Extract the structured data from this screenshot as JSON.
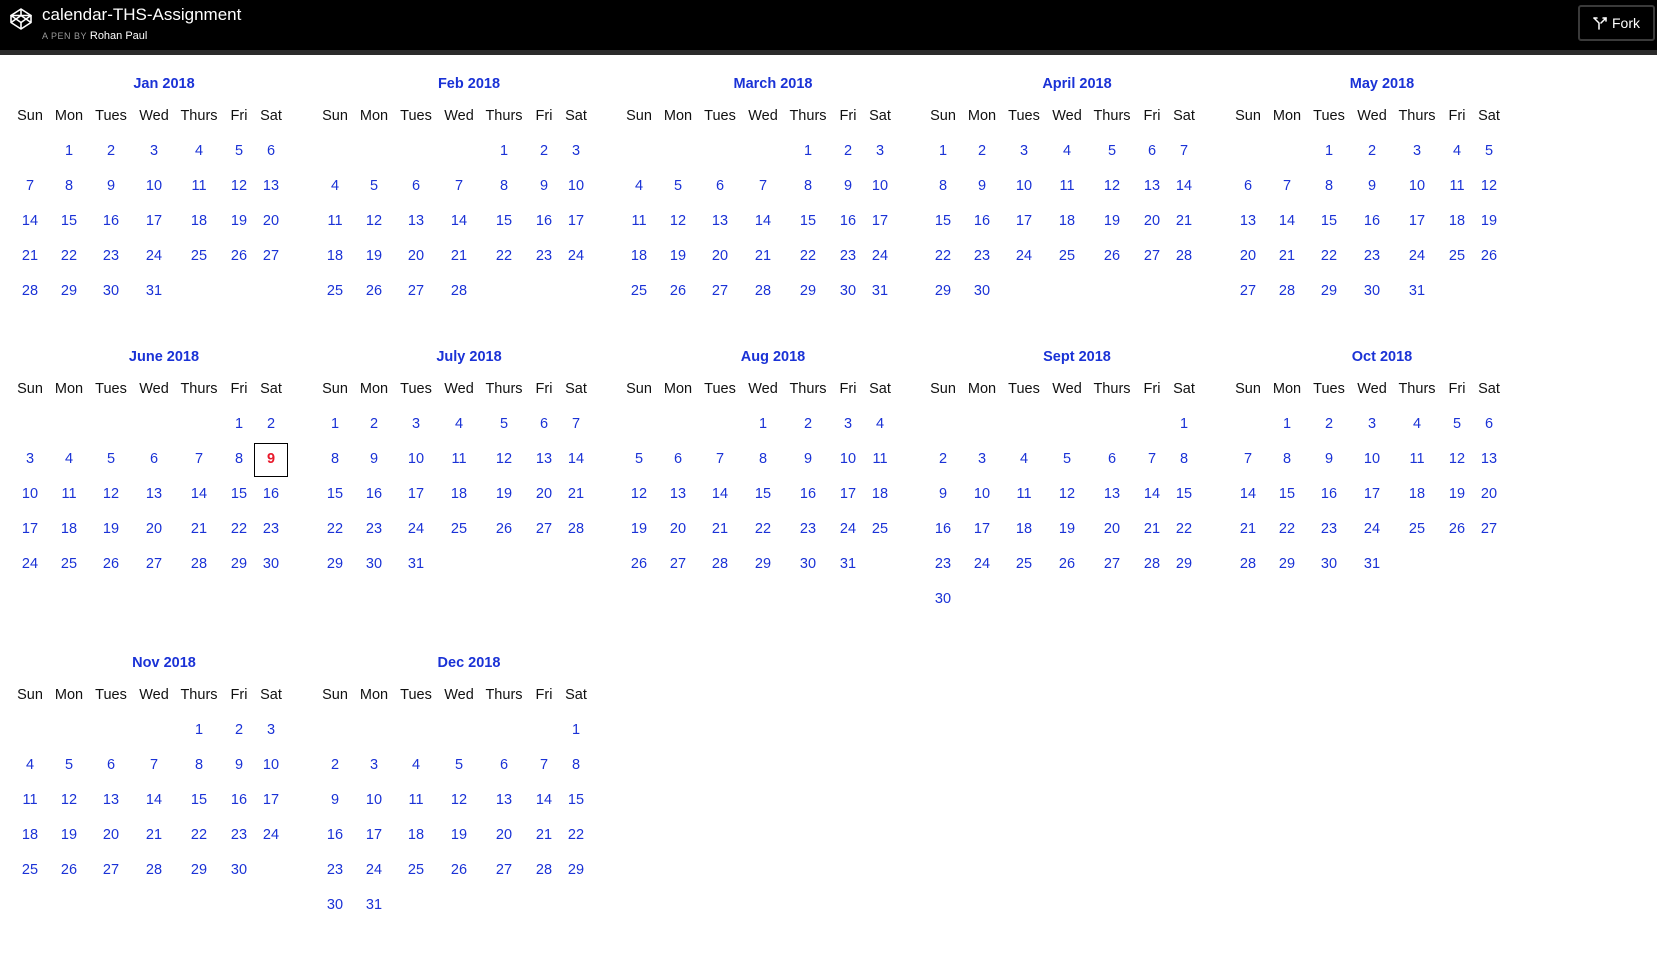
{
  "header": {
    "title": "calendar-THS-Assignment",
    "by_label": "A PEN BY",
    "author": "Rohan Paul",
    "fork_label": "Fork",
    "logo_icon": "codepen-logo-icon",
    "fork_icon": "fork-icon"
  },
  "weekdays": [
    "Sun",
    "Mon",
    "Tues",
    "Wed",
    "Thurs",
    "Fri",
    "Sat"
  ],
  "highlight": {
    "month_index": 5,
    "day": 9,
    "color": "#e8182a"
  },
  "colors": {
    "accent": "#1a32d6",
    "topbar": "#000000"
  },
  "months": [
    {
      "title": "Jan 2018",
      "start": 1,
      "days": 31
    },
    {
      "title": "Feb 2018",
      "start": 4,
      "days": 28
    },
    {
      "title": "March 2018",
      "start": 4,
      "days": 31
    },
    {
      "title": "April 2018",
      "start": 0,
      "days": 30
    },
    {
      "title": "May 2018",
      "start": 2,
      "days": 31
    },
    {
      "title": "June 2018",
      "start": 5,
      "days": 30
    },
    {
      "title": "July 2018",
      "start": 0,
      "days": 31
    },
    {
      "title": "Aug 2018",
      "start": 3,
      "days": 31
    },
    {
      "title": "Sept 2018",
      "start": 6,
      "days": 30
    },
    {
      "title": "Oct 2018",
      "start": 1,
      "days": 31
    },
    {
      "title": "Nov 2018",
      "start": 4,
      "days": 30
    },
    {
      "title": "Dec 2018",
      "start": 6,
      "days": 31
    }
  ]
}
